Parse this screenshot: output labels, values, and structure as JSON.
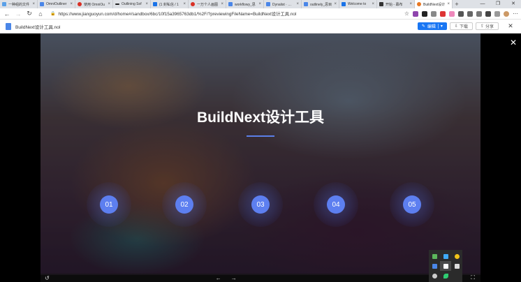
{
  "browser": {
    "tabs": [
      {
        "title": "一种组的文件",
        "icon": "document-icon",
        "color": "#5aa0e8",
        "active": false
      },
      {
        "title": "OmniOutliner",
        "icon": "jianguoyun-icon",
        "color": "#4a86e8",
        "active": false
      },
      {
        "title": "使用 OmniOu",
        "icon": "red-circle-icon",
        "color": "#d93025",
        "active": false
      },
      {
        "title": "Outlining Sof",
        "icon": "dash-icon",
        "color": "#222222",
        "active": false
      },
      {
        "title": "(1 封私信 / 1",
        "icon": "zhihu-icon",
        "color": "#1a73e8",
        "active": false
      },
      {
        "title": "一万个人画图",
        "icon": "red-circle-icon",
        "color": "#d93025",
        "active": false
      },
      {
        "title": "workflowy_思",
        "icon": "jianguoyun-icon",
        "color": "#4a86e8",
        "active": false
      },
      {
        "title": "Dynalist · 看一",
        "icon": "jianguoyun-icon",
        "color": "#4a86e8",
        "active": false
      },
      {
        "title": "outlinely_思目",
        "icon": "jianguoyun-icon",
        "color": "#4a86e8",
        "active": false
      },
      {
        "title": "Welcome to",
        "icon": "outline-icon",
        "color": "#1a73e8",
        "active": false
      },
      {
        "title": "开始 - 幕布",
        "icon": "bracket-icon",
        "color": "#333333",
        "active": false
      },
      {
        "title": "BuildNext设计",
        "icon": "jianguoyun-icon",
        "color": "#e87722",
        "active": true
      }
    ],
    "new_tab": "+",
    "window_buttons": {
      "minimize": "—",
      "maximize": "❐",
      "close": "✕"
    },
    "nav": {
      "back": "←",
      "forward": "→",
      "reload": "↻",
      "home": "⌂"
    },
    "url": "https://www.jianguoyun.com/d/home#/sandbox/6bc/10f15a3965763db1/%2F/?previewingFileName=BuildNext设计工具.nol"
  },
  "file_bar": {
    "filename": "BuildNext设计工具.nol",
    "edit_label": "编辑",
    "edit_caret": "▾",
    "download_label": "下载",
    "share_label": "分享",
    "close": "✕"
  },
  "slide": {
    "title": "BuildNext设计工具",
    "nodes": [
      "01",
      "02",
      "03",
      "04",
      "05"
    ],
    "accent": "#5d7ff0"
  },
  "viewer": {
    "close": "✕",
    "rotate": "↺",
    "prev": "←",
    "next": "→",
    "fullscreen": "⛶"
  },
  "tray_icons": [
    {
      "name": "green-app-icon",
      "color": "#5cb85c"
    },
    {
      "name": "blue-app-icon",
      "color": "#3fa9f5"
    },
    {
      "name": "chat-icon",
      "color": "#f0c419"
    },
    {
      "name": "a-icon",
      "color": "#4a86e8"
    },
    {
      "name": "bookmark-icon",
      "color": "#ffffff"
    },
    {
      "name": "window-icon",
      "color": "#dddddd"
    },
    {
      "name": "sync-icon",
      "color": "#cccccc"
    },
    {
      "name": "leaf-icon",
      "color": "#2ecc71"
    }
  ]
}
